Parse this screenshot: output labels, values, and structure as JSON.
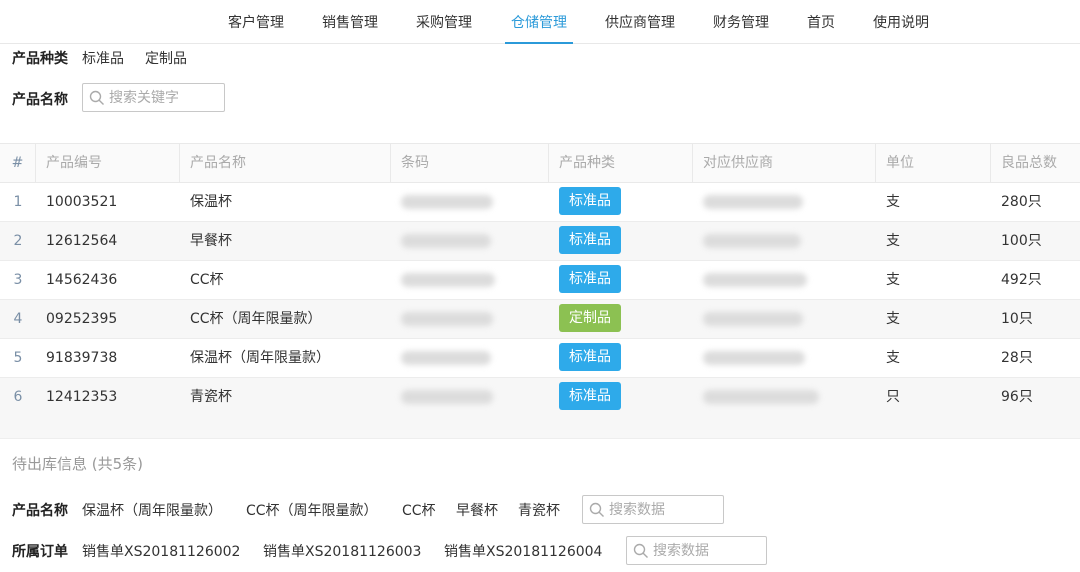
{
  "nav": {
    "items": [
      "客户管理",
      "销售管理",
      "采购管理",
      "仓储管理",
      "供应商管理",
      "财务管理",
      "首页",
      "使用说明"
    ],
    "active_index": 3,
    "accent": "#2b9ad9"
  },
  "filters": {
    "category_label": "产品种类",
    "category_options": [
      "标准品",
      "定制品"
    ],
    "name_label": "产品名称",
    "name_placeholder": "搜索关键字"
  },
  "table": {
    "columns": [
      "#",
      "产品编号",
      "产品名称",
      "条码",
      "产品种类",
      "对应供应商",
      "单位",
      "良品总数"
    ],
    "rows": [
      {
        "idx": "1",
        "code": "10003521",
        "name": "保温杯",
        "category": "标准品",
        "cat_color": "#2eaaea",
        "unit": "支",
        "total": "280只"
      },
      {
        "idx": "2",
        "code": "12612564",
        "name": "早餐杯",
        "category": "标准品",
        "cat_color": "#2eaaea",
        "unit": "支",
        "total": "100只"
      },
      {
        "idx": "3",
        "code": "14562436",
        "name": "CC杯",
        "category": "标准品",
        "cat_color": "#2eaaea",
        "unit": "支",
        "total": "492只"
      },
      {
        "idx": "4",
        "code": "09252395",
        "name": "CC杯（周年限量款）",
        "category": "定制品",
        "cat_color": "#8cc152",
        "unit": "支",
        "total": "10只"
      },
      {
        "idx": "5",
        "code": "91839738",
        "name": "保温杯（周年限量款）",
        "category": "标准品",
        "cat_color": "#2eaaea",
        "unit": "支",
        "total": "28只"
      },
      {
        "idx": "6",
        "code": "12412353",
        "name": "青瓷杯",
        "category": "标准品",
        "cat_color": "#2eaaea",
        "unit": "只",
        "total": "96只"
      }
    ]
  },
  "outbound": {
    "title": "待出库信息 (共5条)",
    "name_label": "产品名称",
    "name_options": [
      "保温杯（周年限量款）",
      "CC杯（周年限量款）",
      "CC杯",
      "早餐杯",
      "青瓷杯"
    ],
    "name_placeholder": "搜索数据",
    "order_label": "所属订单",
    "order_options": [
      "销售单XS20181126002",
      "销售单XS20181126003",
      "销售单XS20181126004"
    ],
    "order_placeholder": "搜索数据"
  }
}
